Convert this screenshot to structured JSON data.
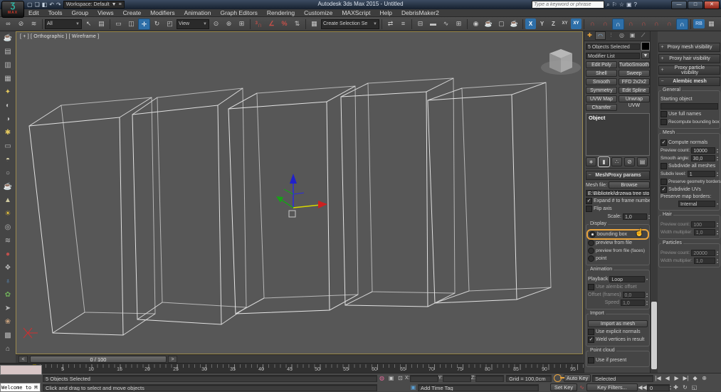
{
  "app": {
    "logo_glyph": "Ʒ",
    "logo_text": "MAX",
    "title": "Autodesk 3ds Max 2015 - Untitled",
    "workspace": "Workspace: Default",
    "search_placeholder": "Type a keyword or phrase",
    "search_icons": [
      "⌕",
      "⚐",
      "☆",
      "▣",
      "?"
    ],
    "window": {
      "min": "—",
      "max": "□",
      "close": "✕"
    }
  },
  "ui": {
    "plus": "+",
    "minus": "−",
    "check": "✓",
    "caret": "▼",
    "spin_up": "▴",
    "spin_dn": "▾",
    "browse_caret": "▾",
    "menu_btn": "≡"
  },
  "qat": [
    "▢",
    "❏",
    "◧",
    "↶",
    "↷"
  ],
  "menus": [
    "Edit",
    "Tools",
    "Group",
    "Views",
    "Create",
    "Modifiers",
    "Animation",
    "Graph Editors",
    "Rendering",
    "Customize",
    "MAXScript",
    "Help",
    "DebrisMaker2"
  ],
  "toolbar": {
    "filter": "All",
    "coord": "View",
    "sets": "Create Selection Se",
    "snap_sup": "3",
    "glyphs": [
      "∞",
      "⊘",
      "≋",
      "↖",
      "▤",
      "▭",
      "◫",
      "✛",
      "↻",
      "◰",
      "⊙",
      "⊛",
      "⊞",
      "∩",
      "∠",
      "%",
      "⇅",
      "▦",
      "⇄",
      "≡",
      "⊟",
      "▬",
      "∿",
      "⊞",
      "◉",
      "☕",
      "▢",
      "☕"
    ],
    "axis": [
      "X",
      "Y",
      "Z",
      "XY",
      "XY"
    ],
    "snaps": [
      "∩",
      "∩",
      "∩",
      "∩",
      "∩",
      "∩",
      "∩",
      "∩"
    ],
    "extras": [
      "RB",
      "▦",
      "↺",
      "▩",
      "♦"
    ]
  },
  "left_toolbar": {
    "glyphs": [
      "☕",
      "▤",
      "▥",
      "▦",
      "✦",
      "◐",
      "◑",
      "✱",
      "▭",
      "◓",
      "○",
      "☕",
      "▲",
      "☀",
      "◎",
      "≋",
      "●",
      "❖",
      "♁",
      "✿",
      "➤",
      "❀",
      "▩",
      "⌂"
    ]
  },
  "viewport": {
    "label": "[ + ] [ Orthographic ] [ Wireframe ]"
  },
  "slider": {
    "prev": "<",
    "value": "0 / 100",
    "next": ">"
  },
  "ruler": {
    "labels": [
      "5",
      "10",
      "15",
      "20",
      "25",
      "30",
      "35",
      "40",
      "45",
      "50",
      "55",
      "60",
      "65",
      "70",
      "75",
      "80",
      "85",
      "90",
      "95",
      "100"
    ]
  },
  "panel": {
    "selected": "5 Objects Selected",
    "modifier_list": "Modifier List",
    "buttons": [
      "Edit Poly",
      "TurboSmooth",
      "Shell",
      "Sweep",
      "Smooth",
      "FFD 2x2x2",
      "Symmetry",
      "Edit Spline",
      "UVW Map",
      "Unwrap UVW",
      "Chamfer"
    ],
    "stack_item": "Object",
    "stack_tools": [
      "∗",
      "▮",
      "∴",
      "⊘",
      "▤"
    ],
    "meshproxy": {
      "title": "MeshProxy params",
      "mesh_file": "Mesh file:",
      "browse": "Browse",
      "path": "E:\\Biblioteki\\drzewa tree stor",
      "expand": "Expand # to frame number",
      "flip": "Flip axis",
      "scale_label": "Scale:",
      "scale": "1,0",
      "display": {
        "title": "Display",
        "options": [
          "bounding box",
          "preview from file",
          "preview from file (faces)",
          "point"
        ]
      },
      "animation": {
        "title": "Animation",
        "playback": "Playback",
        "playback_value": "Loop",
        "alembic_offset": "Use alembic offset",
        "offset_label": "Offset (frames)",
        "offset": "0,0",
        "speed_label": "Speed",
        "speed": "1,0"
      },
      "import": {
        "title": "Import",
        "button": "Import as mesh",
        "explicit": "Use explicit normals",
        "weld": "Weld vertices in result"
      },
      "point_cloud": {
        "title": "Point cloud",
        "use": "Use if present"
      }
    }
  },
  "right_panel": {
    "rollouts": [
      "Proxy mesh visibility",
      "Proxy hair visibility",
      "Proxy particle visibility"
    ],
    "alembic": {
      "title": "Alembic mesh",
      "general": {
        "title": "General",
        "starting": "Starting object",
        "full_names": "Use full names",
        "recompute": "Recompute bounding box"
      },
      "mesh": {
        "title": "Mesh",
        "compute": "Compute normals",
        "preview_label": "Preview count:",
        "preview": "10000",
        "smooth_label": "Smooth angle:",
        "smooth": "30,0",
        "subdivide_all": "Subdivide all meshes",
        "subdiv_label": "Subdiv level:",
        "subdiv": "1",
        "preserve_geo": "Preserve geometry borders",
        "subdivide_uvs": "Subdivide UVs",
        "map_borders": "Preserve map borders:",
        "map_value": "Internal"
      },
      "hair": {
        "title": "Hair",
        "preview_label": "Preview count:",
        "preview": "100",
        "width_label": "Width multiplier:",
        "width": "1,0"
      },
      "particles": {
        "title": "Particles",
        "preview_label": "Preview count:",
        "preview": "20000",
        "width_label": "Width multiplier:",
        "width": "1,0"
      }
    }
  },
  "status": {
    "selected": "5 Objects Selected",
    "prompt": "Click and drag to select and move objects",
    "x": "X:",
    "y": "Y:",
    "z": "Z:",
    "grid": "Grid = 100,0cm",
    "add_time_tag": "Add Time Tag",
    "auto_key": "Auto Key",
    "set_key": "Set Key",
    "selected_dd": "Selected",
    "key_filters": "Key Filters...",
    "frame": "0",
    "listener": "Welcome to M",
    "isolate": "◍",
    "lock": "▣",
    "absolute": "⊡",
    "tag_icon": "▣",
    "trackbar_icon": "▤",
    "curves_icon": "∿",
    "playback": [
      "|◀",
      "◀",
      "▶",
      "▶|",
      "◆",
      "⊕"
    ],
    "rewind": "◀◀",
    "nav": [
      "✚",
      "↻",
      "◱"
    ]
  }
}
